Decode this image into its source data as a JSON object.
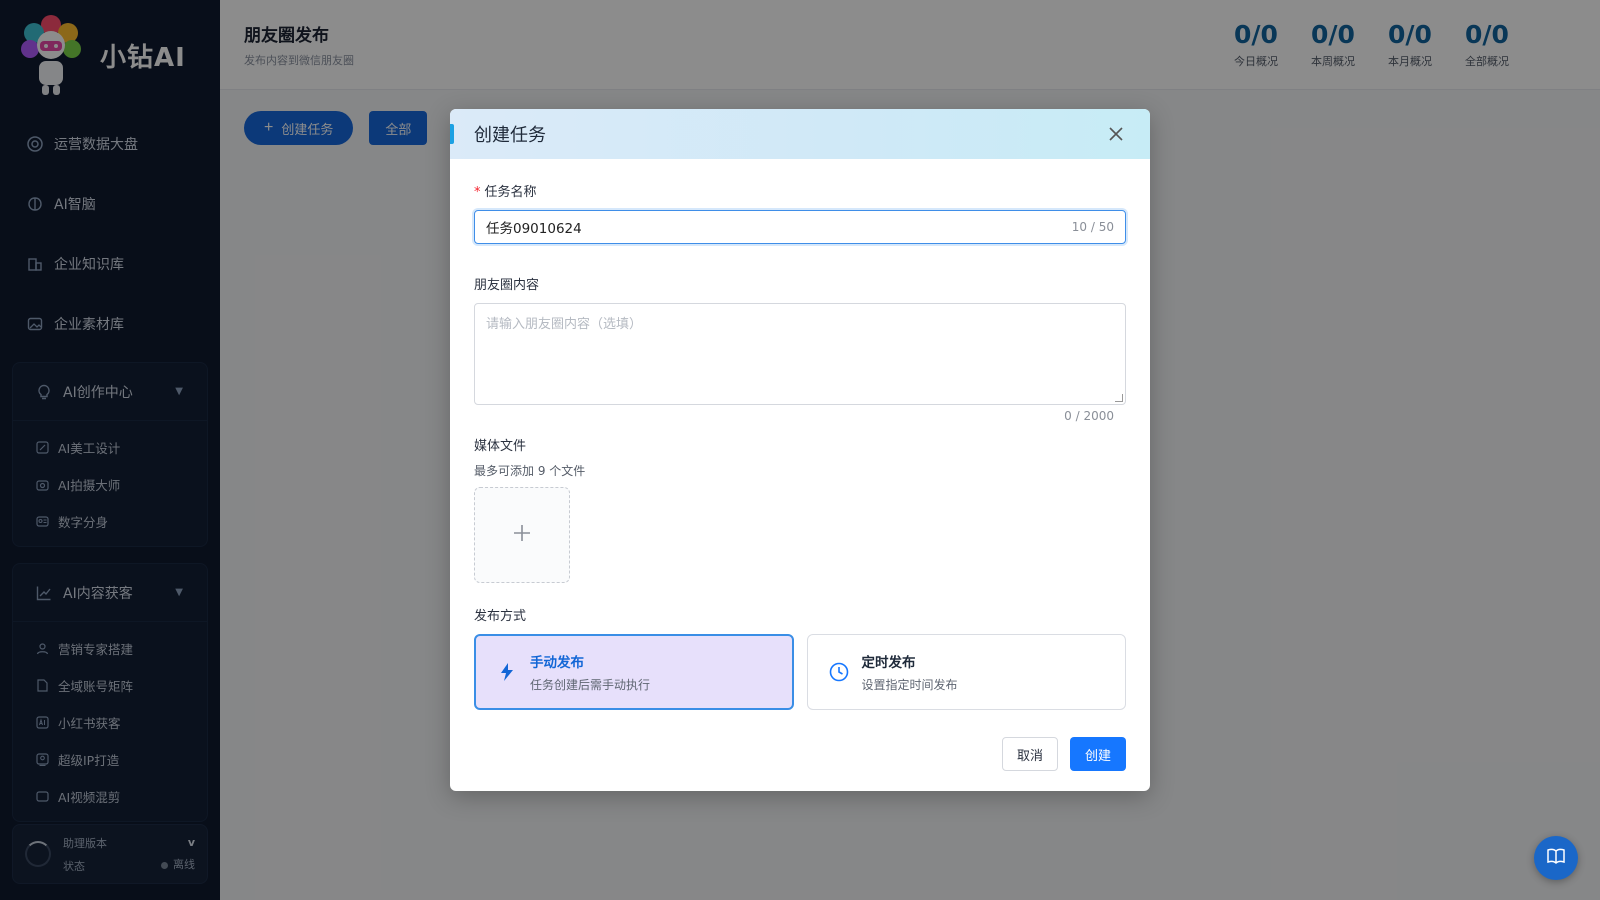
{
  "app": {
    "name": "小钻AI"
  },
  "sidebar": {
    "top_items": [
      {
        "label": "运营数据大盘",
        "icon": "dashboard-icon"
      },
      {
        "label": "AI智脑",
        "icon": "brain-icon"
      },
      {
        "label": "企业知识库",
        "icon": "building-icon"
      },
      {
        "label": "企业素材库",
        "icon": "image-icon"
      }
    ],
    "groups": [
      {
        "label": "AI创作中心",
        "icon": "lightbulb-icon",
        "items": [
          {
            "label": "AI美工设计"
          },
          {
            "label": "AI拍摄大师"
          },
          {
            "label": "数字分身"
          }
        ]
      },
      {
        "label": "AI内容获客",
        "icon": "trend-icon",
        "items": [
          {
            "label": "营销专家搭建"
          },
          {
            "label": "全域账号矩阵"
          },
          {
            "label": "小红书获客"
          },
          {
            "label": "超级IP打造"
          },
          {
            "label": "AI视频混剪"
          }
        ]
      }
    ],
    "status": {
      "version_label": "助理版本",
      "version_value": "v",
      "state_label": "状态",
      "state_value": "离线"
    }
  },
  "header": {
    "title": "朋友圈发布",
    "subtitle": "发布内容到微信朋友圈",
    "stats": [
      {
        "value": "0/0",
        "label": "今日概况"
      },
      {
        "value": "0/0",
        "label": "本周概况"
      },
      {
        "value": "0/0",
        "label": "本月概况"
      },
      {
        "value": "0/0",
        "label": "全部概况"
      }
    ]
  },
  "toolbar": {
    "create_label": "创建任务",
    "filter_label": "全部"
  },
  "modal": {
    "title": "创建任务",
    "name_label": "任务名称",
    "name_value": "任务09010624",
    "name_count": "10 / 50",
    "content_label": "朋友圈内容",
    "content_placeholder": "请输入朋友圈内容（选填）",
    "content_count": "0 / 2000",
    "media_label": "媒体文件",
    "media_hint": "最多可添加 9 个文件",
    "publish_label": "发布方式",
    "publish_options": [
      {
        "title": "手动发布",
        "desc": "任务创建后需手动执行",
        "selected": true
      },
      {
        "title": "定时发布",
        "desc": "设置指定时间发布",
        "selected": false
      }
    ],
    "cancel_label": "取消",
    "submit_label": "创建"
  },
  "colors": {
    "primary": "#1677ff",
    "sidebar_bg": "#0f1a2e",
    "stat_value": "#12649e",
    "selected_card_bg": "#e7e0fb"
  }
}
